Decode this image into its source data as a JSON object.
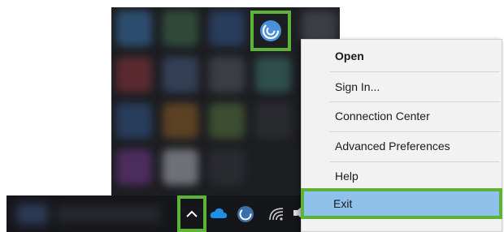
{
  "tray_flyout": {
    "slots": [
      "s-blue",
      "s-green",
      "s-navy",
      "app",
      "s-gray",
      "s-red",
      "s-slate",
      "s-gray",
      "s-teal",
      "",
      "s-navy",
      "s-orange",
      "s-lime",
      "s-dark",
      "",
      "s-purple",
      "s-light",
      "s-dark",
      "",
      ""
    ]
  },
  "context_menu": {
    "items": [
      {
        "label": "Open"
      },
      {
        "label": "Sign In..."
      },
      {
        "label": "Connection Center"
      },
      {
        "label": "Advanced Preferences"
      },
      {
        "label": "Help"
      },
      {
        "label": "Exit"
      }
    ]
  },
  "colors": {
    "highlight_border": "#5db338",
    "exit_highlight": "#8fc1ea",
    "menu_background": "#f2f2f2",
    "taskbar": "#151619",
    "app_icon": "#4a90d9"
  },
  "icons": {
    "app": "app-receiver-icon",
    "chevron": "chevron-up-icon",
    "onedrive": "cloud-icon",
    "app_taskbar": "app-receiver-icon",
    "network": "wifi-icon",
    "volume": "speaker-icon",
    "notifications": "action-center-icon"
  }
}
